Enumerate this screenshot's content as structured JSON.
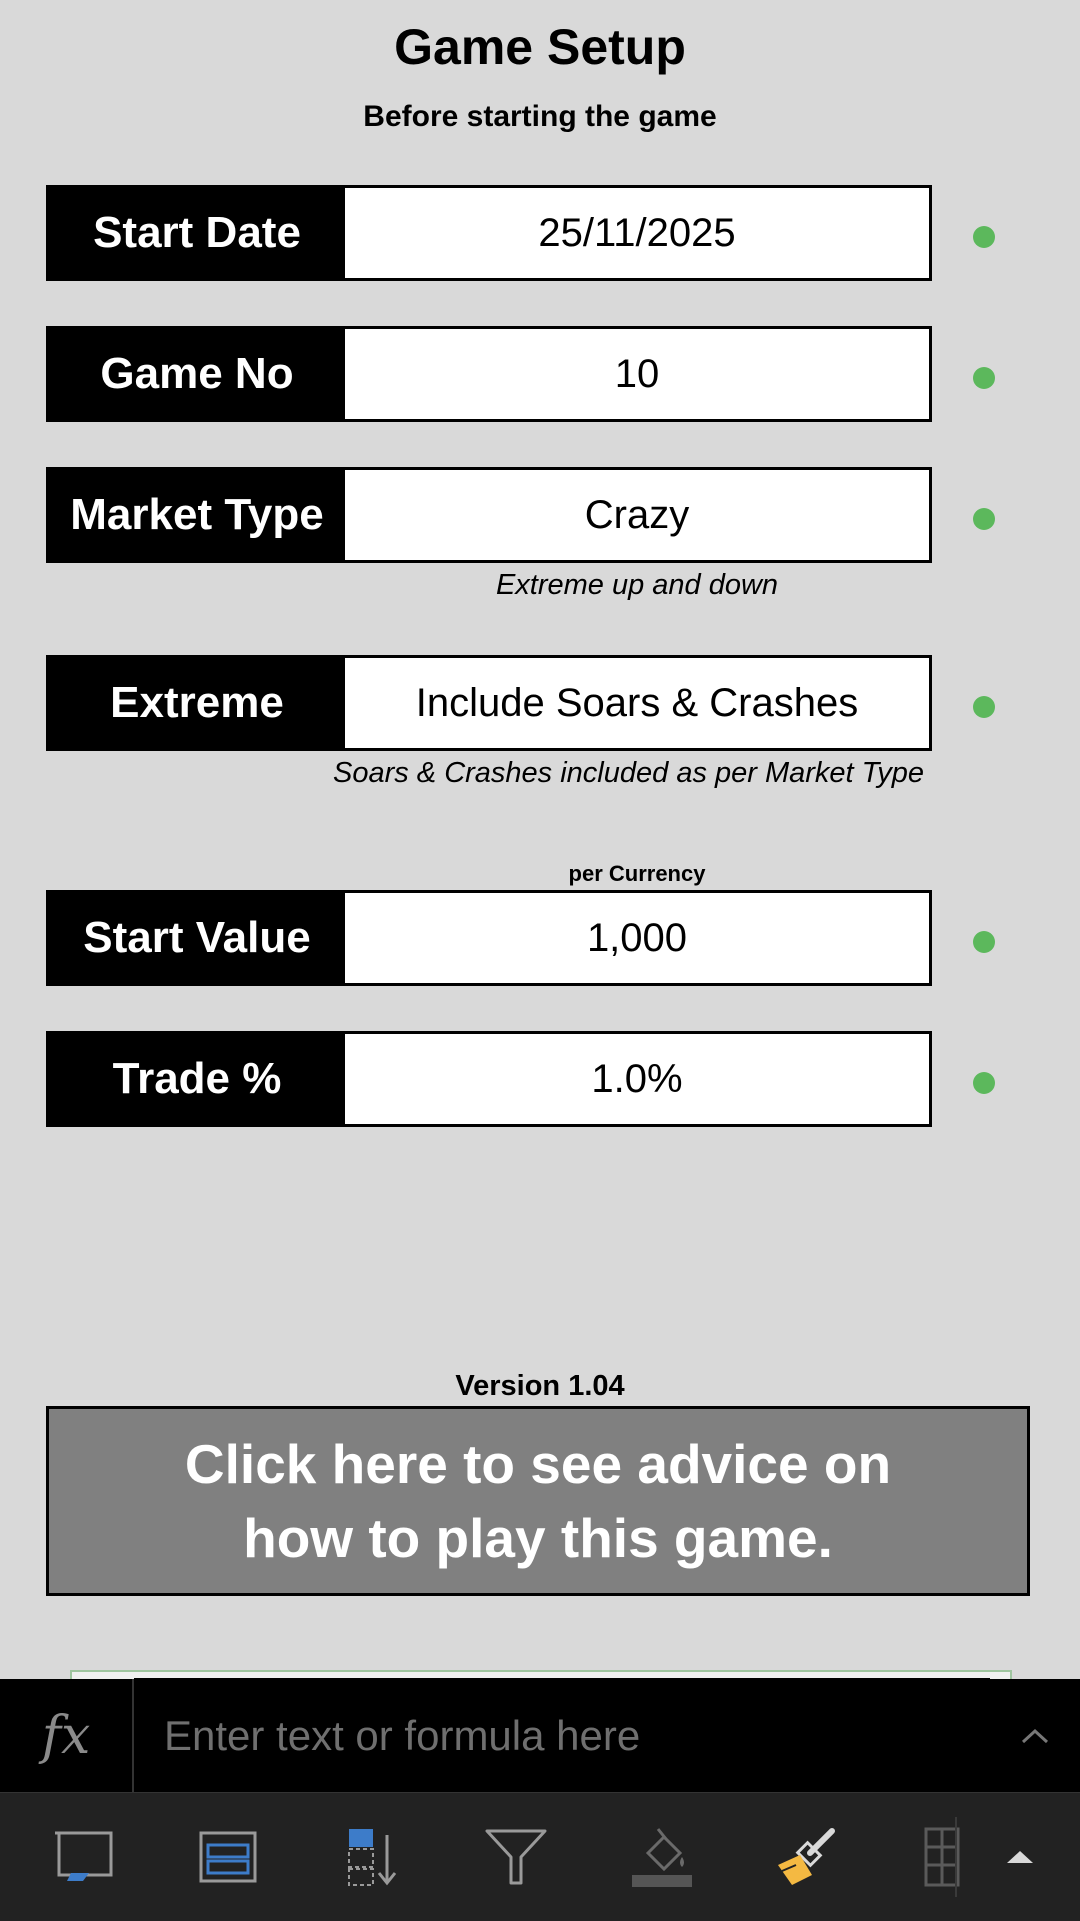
{
  "header": {
    "title": "Game Setup",
    "subtitle": "Before starting the game"
  },
  "fields": [
    {
      "label": "Start Date",
      "value": "25/11/2025",
      "status": "valid"
    },
    {
      "label": "Game No",
      "value": "10",
      "status": "valid"
    },
    {
      "label": "Market Type",
      "value": "Crazy",
      "status": "valid",
      "note": "Extreme up and down"
    },
    {
      "label": "Extreme",
      "value": "Include Soars & Crashes",
      "status": "valid",
      "note": "Soars & Crashes included as per Market Type"
    },
    {
      "label": "Start Value",
      "value": "1,000",
      "status": "valid",
      "caption": "per Currency"
    },
    {
      "label": "Trade %",
      "value": "1.0%",
      "status": "valid"
    }
  ],
  "version": "Version 1.04",
  "advice_button": "Click here to see advice on how to play this game.",
  "formula_bar": {
    "fx_label": "fx",
    "placeholder": "Enter text or formula here"
  },
  "toolbar": {
    "icons": [
      "freeze-panes-icon",
      "freeze-rows-icon",
      "sort-icon",
      "filter-icon",
      "fill-color-icon",
      "format-painter-icon",
      "table-icon",
      "expand-up-icon"
    ]
  },
  "colors": {
    "status_dot": "#5cb85c",
    "label_bg": "#000000",
    "advice_bg": "#808080",
    "sheet_bg": "#d9d9d9"
  }
}
